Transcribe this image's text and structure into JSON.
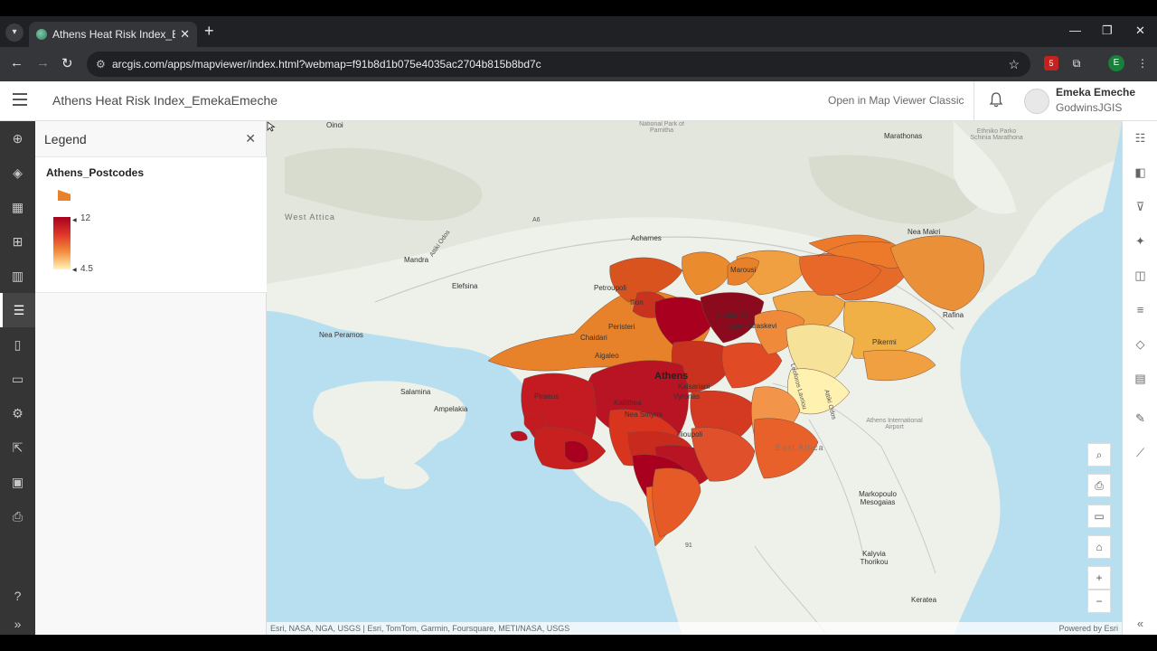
{
  "browser": {
    "tab_title": "Athens Heat Risk Index_EmekaE",
    "url": "arcgis.com/apps/mapviewer/index.html?webmap=f91b8d1b075e4035ac2704b815b8bd7c",
    "profile_initial": "E",
    "extension_badge": "5"
  },
  "header": {
    "title": "Athens Heat Risk Index_EmekaEmeche",
    "open_classic": "Open in Map Viewer Classic",
    "user_name": "Emeka Emeche",
    "user_org": "GodwinsJGIS"
  },
  "left_toolbar": [
    "add-icon",
    "layers-icon",
    "table-icon",
    "basemap-icon",
    "charts-icon",
    "legend-icon",
    "bookmarks-icon",
    "folder-icon",
    "settings-icon",
    "share-icon",
    "apps-icon",
    "print-icon",
    "help-icon",
    "expand-icon"
  ],
  "legend": {
    "panel_title": "Legend",
    "layer_name": "Athens_Postcodes",
    "ramp_max": "12",
    "ramp_min": "4.5",
    "colors": [
      "#a8001e",
      "#e03a2a",
      "#f28a3a",
      "#fff5b8"
    ]
  },
  "map": {
    "places": [
      {
        "name": "Oinoi",
        "cls": ""
      },
      {
        "name": "National Park of Parnitha",
        "cls": "light"
      },
      {
        "name": "Marathonas",
        "cls": ""
      },
      {
        "name": "Ethniko Parko Schinia Marathona",
        "cls": "light"
      },
      {
        "name": "West Attica",
        "cls": "region"
      },
      {
        "name": "Acharnes",
        "cls": ""
      },
      {
        "name": "Mandra",
        "cls": ""
      },
      {
        "name": "Nea Makri",
        "cls": ""
      },
      {
        "name": "Marousi",
        "cls": ""
      },
      {
        "name": "Petroupoli",
        "cls": ""
      },
      {
        "name": "Ilion",
        "cls": ""
      },
      {
        "name": "Elefsina",
        "cls": ""
      },
      {
        "name": "Chalandri",
        "cls": ""
      },
      {
        "name": "Agia Paraskevi",
        "cls": ""
      },
      {
        "name": "Rafina",
        "cls": ""
      },
      {
        "name": "Peristeri",
        "cls": ""
      },
      {
        "name": "Chaidari",
        "cls": ""
      },
      {
        "name": "Nea Peramos",
        "cls": ""
      },
      {
        "name": "Pikermi",
        "cls": ""
      },
      {
        "name": "Athens",
        "cls": "big"
      },
      {
        "name": "Aigaleo",
        "cls": ""
      },
      {
        "name": "Kaisariani",
        "cls": ""
      },
      {
        "name": "Vyronas",
        "cls": ""
      },
      {
        "name": "Salamina",
        "cls": ""
      },
      {
        "name": "Piraeus",
        "cls": ""
      },
      {
        "name": "Ampelakia",
        "cls": ""
      },
      {
        "name": "Kallithea",
        "cls": ""
      },
      {
        "name": "Nea Smyrni",
        "cls": ""
      },
      {
        "name": "Athens International Airport",
        "cls": "light"
      },
      {
        "name": "Ilioupoli",
        "cls": ""
      },
      {
        "name": "East Attica",
        "cls": "region"
      },
      {
        "name": "Markopoulo Mesogaias",
        "cls": ""
      },
      {
        "name": "Kalyvia Thorikou",
        "cls": ""
      },
      {
        "name": "Keratea",
        "cls": ""
      },
      {
        "name": "Attiki Odos",
        "cls": "road"
      },
      {
        "name": "Leoforos Lavriou",
        "cls": "road"
      },
      {
        "name": "A6",
        "cls": "road"
      },
      {
        "name": "91",
        "cls": "road"
      },
      {
        "name": "Attiki Odos",
        "cls": "road"
      }
    ],
    "attribution": "Esri, NASA, NGA, USGS | Esri, TomTom, Garmin, Foursquare, METI/NASA, USGS",
    "powered_by": "Powered by Esri"
  },
  "map_controls": [
    "search-icon",
    "print-icon",
    "screen-icon",
    "home-icon",
    "zoom-in-icon",
    "zoom-out-icon"
  ],
  "right_toolbar": [
    "properties-icon",
    "styles-icon",
    "filter-icon",
    "effects-icon",
    "popups-icon",
    "labels-icon",
    "fields-icon",
    "analysis-icon",
    "sketch-icon",
    "measure-icon",
    "collapse-icon"
  ]
}
